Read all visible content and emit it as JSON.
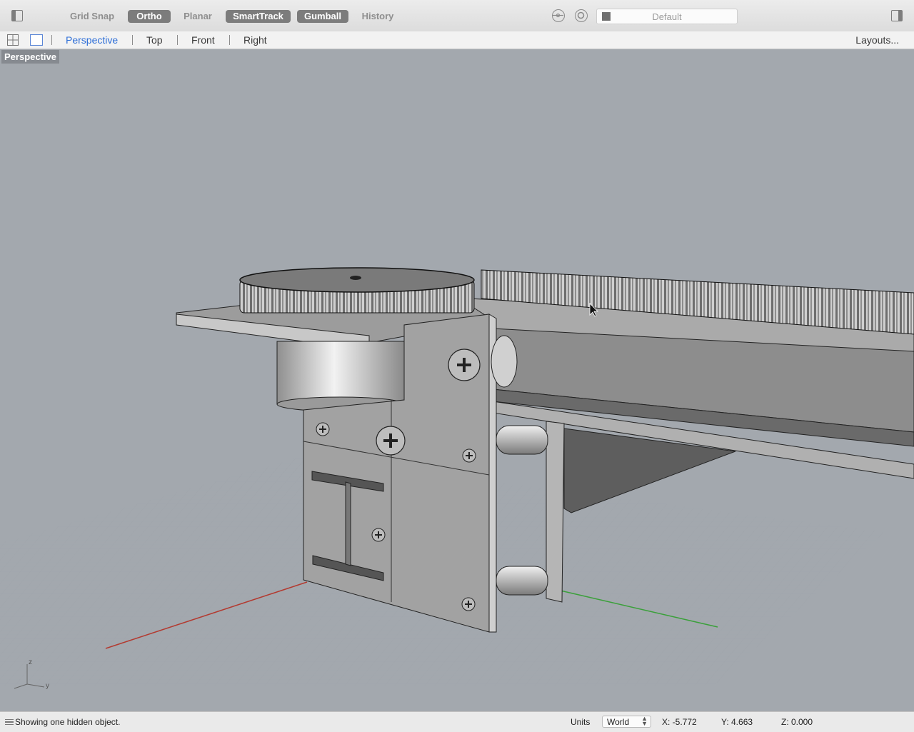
{
  "toolbar": {
    "buttons": [
      {
        "label": "Grid Snap",
        "active": false
      },
      {
        "label": "Ortho",
        "active": true
      },
      {
        "label": "Planar",
        "active": false
      },
      {
        "label": "SmartTrack",
        "active": true
      },
      {
        "label": "Gumball",
        "active": true
      },
      {
        "label": "History",
        "active": false
      }
    ],
    "layer": {
      "name": "Default",
      "swatch_color": "#6f6f6f"
    }
  },
  "viewport_tabs": {
    "tabs": [
      "Perspective",
      "Top",
      "Front",
      "Right"
    ],
    "active_tab": "Perspective",
    "layouts_label": "Layouts..."
  },
  "viewport": {
    "label": "Perspective",
    "background_color": "#a3a8ae",
    "axis_colors": {
      "x": "#b33a30",
      "y": "#3aa03a"
    },
    "axis_icon_labels": {
      "z": "z",
      "y": "y"
    }
  },
  "status": {
    "message": "Showing one hidden object.",
    "units_label": "Units",
    "units_value": "World",
    "x": "X: -5.772",
    "y": "Y: 4.663",
    "z": "Z: 0.000"
  }
}
